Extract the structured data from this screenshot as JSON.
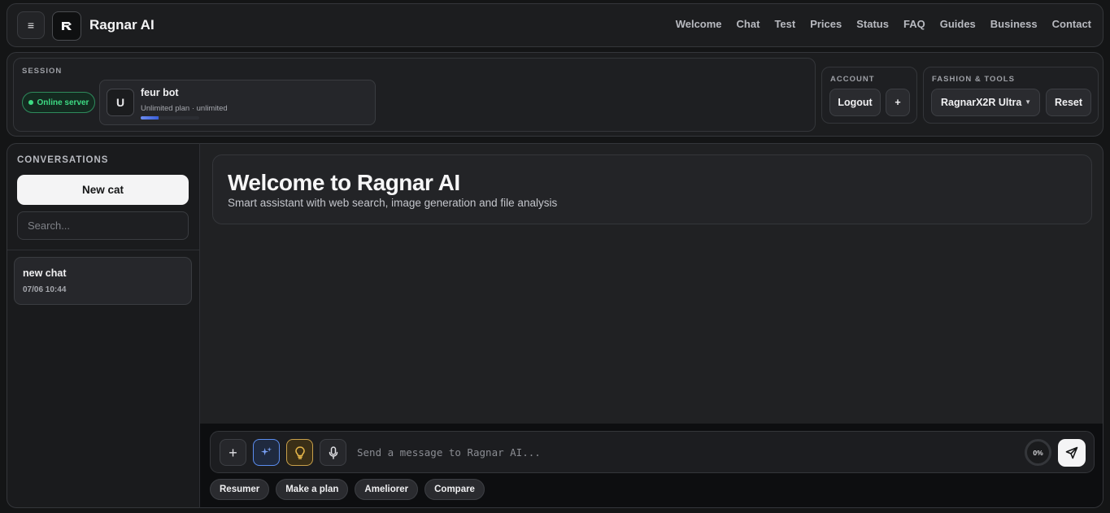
{
  "header": {
    "menu_icon": "hamburger-icon",
    "logo_icon": "ragnar-logo-icon",
    "title": "Ragnar AI",
    "nav": [
      "Welcome",
      "Chat",
      "Test",
      "Prices",
      "Status",
      "FAQ",
      "Guides",
      "Business",
      "Contact"
    ]
  },
  "session": {
    "label": "SESSION",
    "status": "Online server",
    "status_color": "#3ddc84",
    "user": {
      "avatar": "U",
      "name": "feur bot",
      "plan": "Unlimited plan · unlimited",
      "usage_fraction": 0.3
    }
  },
  "account": {
    "label": "ACCOUNT",
    "logout_label": "Logout",
    "add_label": "+"
  },
  "tools": {
    "label": "FASHION & TOOLS",
    "model": "RagnarX2R Ultra",
    "reset_label": "Reset"
  },
  "sidebar": {
    "label": "CONVERSATIONS",
    "new_chat_label": "New cat",
    "search_placeholder": "Search...",
    "chats": [
      {
        "title": "new chat",
        "date": "07/06 10:44"
      }
    ]
  },
  "main": {
    "welcome_title": "Welcome to Ragnar AI",
    "welcome_subtitle": "Smart assistant with web search, image generation and file analysis"
  },
  "composer": {
    "placeholder": "Send a message to Ragnar AI...",
    "progress": "0%",
    "quick_actions": [
      "Resumer",
      "Make a plan",
      "Ameliorer",
      "Compare"
    ],
    "accent_blue": "#5b8def",
    "accent_yellow": "#e8b84a"
  }
}
